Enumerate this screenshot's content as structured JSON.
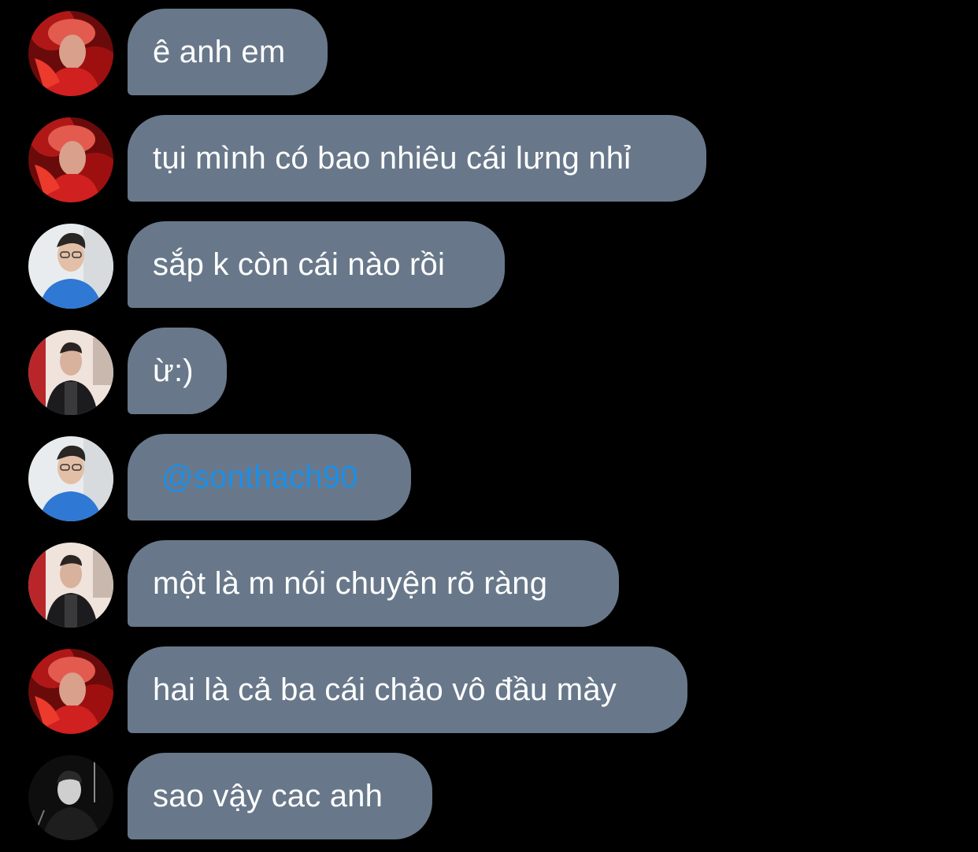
{
  "messages": [
    {
      "sender_avatar": "red-hair-avatar",
      "text": "ê anh em"
    },
    {
      "sender_avatar": "red-hair-avatar",
      "text": "tụi mình có bao nhiêu cái lưng nhỉ"
    },
    {
      "sender_avatar": "blue-shirt-glasses-avatar",
      "text": "sắp k còn cái nào rồi"
    },
    {
      "sender_avatar": "leather-jacket-avatar",
      "text": "ừ:)"
    },
    {
      "sender_avatar": "blue-shirt-glasses-avatar",
      "text": "@sonthach90",
      "is_mention": true
    },
    {
      "sender_avatar": "leather-jacket-avatar",
      "text": "một là m nói chuyện rõ ràng"
    },
    {
      "sender_avatar": "red-hair-avatar",
      "text": "hai là cả ba cái chảo vô đầu mày"
    },
    {
      "sender_avatar": "black-white-avatar",
      "text": "sao vậy cac anh"
    }
  ],
  "colors": {
    "background": "#000000",
    "bubble": "#68788a",
    "text": "#ffffff",
    "mention": "#1b8fe8"
  }
}
